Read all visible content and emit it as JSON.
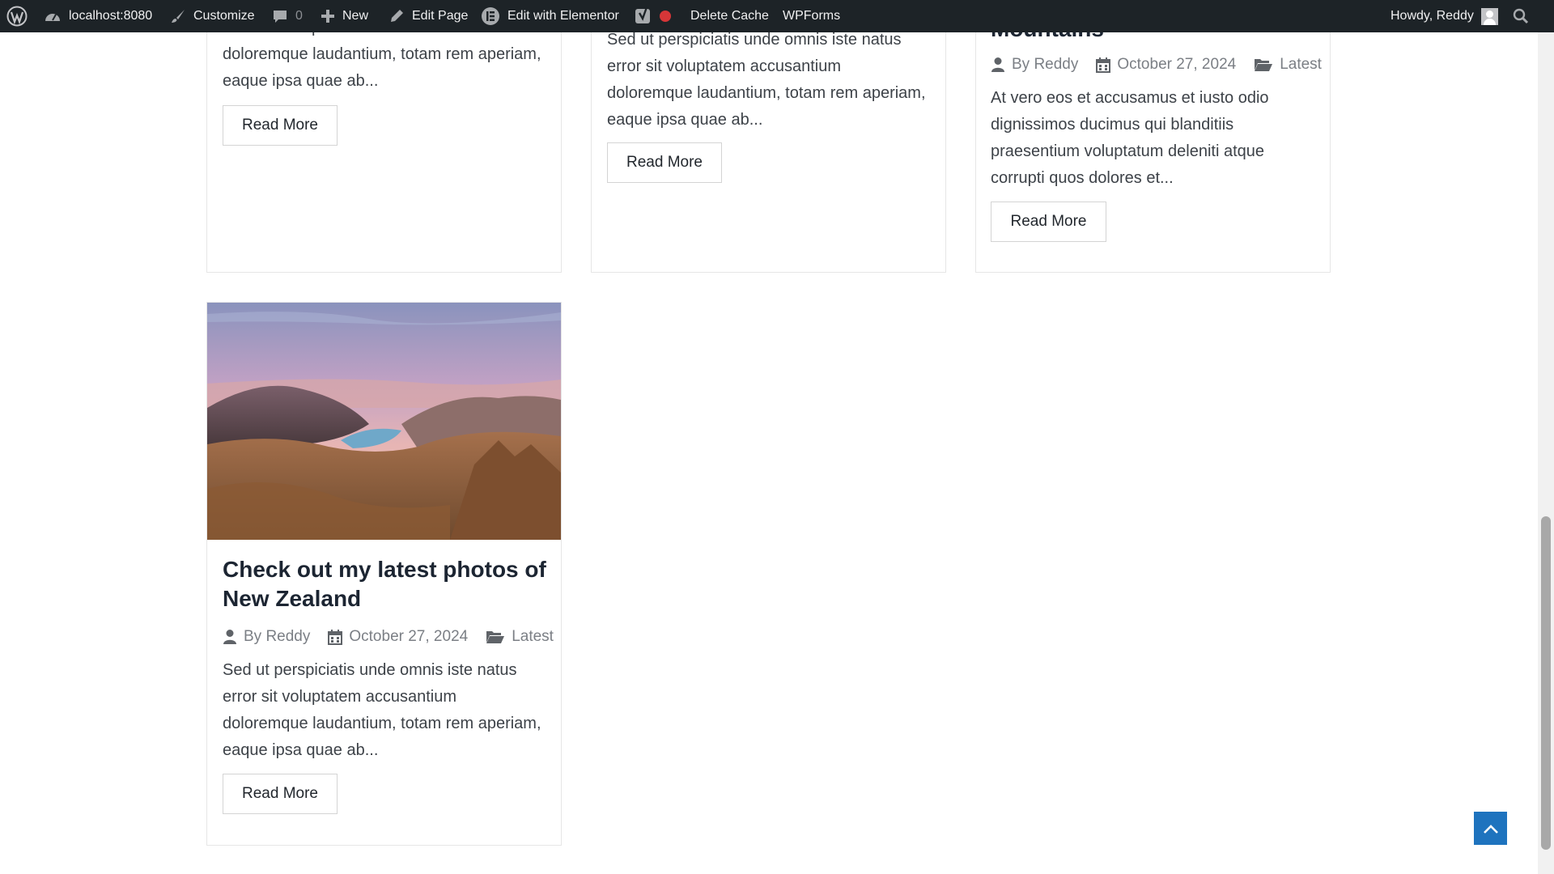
{
  "adminbar": {
    "site": "localhost:8080",
    "customize": "Customize",
    "comments_count": "0",
    "new": "New",
    "edit_page": "Edit Page",
    "edit_elementor": "Edit with Elementor",
    "delete_cache": "Delete Cache",
    "wpforms": "WPForms",
    "howdy": "Howdy, Reddy"
  },
  "posts": [
    {
      "excerpt_lines": [
        "error sit voluptatem accusantium",
        "doloremque laudantium, totam rem aperiam,",
        "eaque ipsa quae ab..."
      ],
      "read_more": "Read More"
    },
    {
      "excerpt_lines": [
        "Sed ut perspiciatis unde omnis iste natus",
        "error sit voluptatem accusantium",
        "doloremque laudantium, totam rem aperiam,",
        "eaque ipsa quae ab..."
      ],
      "read_more": "Read More"
    },
    {
      "title_fragment": "Mountains",
      "author": "By Reddy",
      "date": "October 27, 2024",
      "category": "Latest",
      "excerpt_lines": [
        "At vero eos et accusamus et iusto odio",
        "dignissimos ducimus qui blanditiis",
        "praesentium voluptatum deleniti atque",
        "corrupti quos dolores et..."
      ],
      "read_more": "Read More"
    },
    {
      "title": "Check out my latest photos of New Zealand",
      "author": "By Reddy",
      "date": "October 27, 2024",
      "category": "Latest",
      "excerpt_lines": [
        "Sed ut perspiciatis unde omnis iste natus",
        "error sit voluptatem accusantium",
        "doloremque laudantium, totam rem aperiam,",
        "eaque ipsa quae ab..."
      ],
      "read_more": "Read More"
    }
  ],
  "colors": {
    "adminbar_bg": "#1d2327",
    "accent": "#1e73be",
    "status_dot": "#d63638"
  }
}
